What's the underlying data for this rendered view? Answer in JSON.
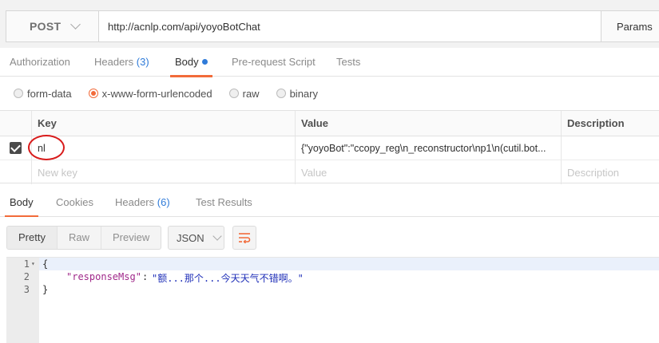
{
  "request": {
    "method": "POST",
    "url": "http://acnlp.com/api/yoyoBotChat",
    "params_label": "Params"
  },
  "request_tabs": [
    {
      "label": "Authorization"
    },
    {
      "label": "Headers",
      "count": "(3)"
    },
    {
      "label": "Body",
      "active": true
    },
    {
      "label": "Pre-request Script"
    },
    {
      "label": "Tests"
    }
  ],
  "body_types": {
    "form_data": "form-data",
    "urlencoded": "x-www-form-urlencoded",
    "raw": "raw",
    "binary": "binary",
    "selected": "x-www-form-urlencoded"
  },
  "kv_table": {
    "headers": {
      "key": "Key",
      "value": "Value",
      "description": "Description"
    },
    "rows": [
      {
        "checked": true,
        "key": "nl",
        "value": "{\"yoyoBot\":\"ccopy_reg\\n_reconstructor\\np1\\n(cutil.bot..."
      }
    ],
    "placeholders": {
      "key": "New key",
      "value": "Value",
      "description": "Description"
    }
  },
  "response_tabs": [
    {
      "label": "Body",
      "active": true
    },
    {
      "label": "Cookies"
    },
    {
      "label": "Headers",
      "count": "(6)"
    },
    {
      "label": "Test Results"
    }
  ],
  "view_modes": {
    "pretty": "Pretty",
    "raw": "Raw",
    "preview": "Preview",
    "selected": "Pretty"
  },
  "format": "JSON",
  "code": {
    "line_numbers": [
      "1",
      "2",
      "3"
    ],
    "open_brace": "{",
    "key": "\"responseMsg\"",
    "colon": ":",
    "value": "\"额...那个...今天天气不错啊。\"",
    "close_brace": "}"
  },
  "colors": {
    "accent": "#f26b3a",
    "count_blue": "#2f7bd9",
    "annotation_red": "#d81b1b"
  }
}
